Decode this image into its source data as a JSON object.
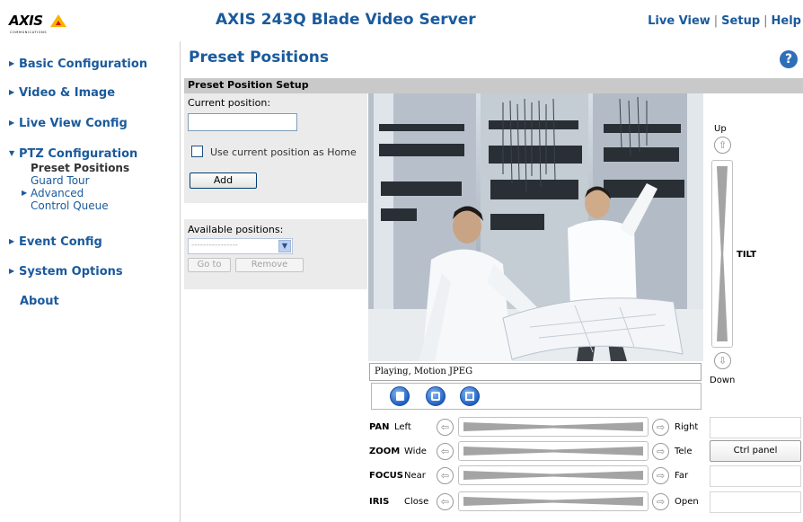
{
  "header": {
    "logo_text": "AXIS",
    "logo_subtext": "COMMUNICATIONS",
    "product_title": "AXIS 243Q Blade Video Server",
    "links": [
      "Live View",
      "Setup",
      "Help"
    ],
    "separator": "|"
  },
  "sidebar": {
    "items": [
      {
        "label": "Basic Configuration",
        "arrow": "▶"
      },
      {
        "label": "Video & Image",
        "arrow": "▶"
      },
      {
        "label": "Live View Config",
        "arrow": "▶"
      },
      {
        "label": "PTZ Configuration",
        "arrow": "▼"
      },
      {
        "label": "Event Config",
        "arrow": "▶"
      },
      {
        "label": "System Options",
        "arrow": "▶"
      },
      {
        "label": "About",
        "arrow": ""
      }
    ],
    "ptz_subitems": [
      {
        "label": "Preset Positions",
        "arrow": "",
        "active": true
      },
      {
        "label": "Guard Tour",
        "arrow": ""
      },
      {
        "label": "Advanced",
        "arrow": "▶"
      },
      {
        "label": "Control Queue",
        "arrow": ""
      }
    ]
  },
  "page": {
    "title": "Preset Positions",
    "help_icon": "?",
    "section_title": "Preset Position Setup"
  },
  "setup": {
    "current_position_label": "Current position:",
    "current_position_value": "",
    "home_checkbox_label": "Use current position as Home",
    "home_checked": false,
    "add_button": "Add"
  },
  "available": {
    "label": "Available positions:",
    "selected_option": "----------------",
    "goto_button": "Go to",
    "remove_button": "Remove"
  },
  "video": {
    "status": "Playing, Motion JPEG"
  },
  "tilt": {
    "label": "TILT",
    "up_label": "Up",
    "down_label": "Down"
  },
  "ptz_rows": [
    {
      "name": "PAN",
      "left": "Left",
      "right": "Right"
    },
    {
      "name": "ZOOM",
      "left": "Wide",
      "right": "Tele"
    },
    {
      "name": "FOCUS",
      "left": "Near",
      "right": "Far"
    },
    {
      "name": "IRIS",
      "left": "Close",
      "right": "Open"
    }
  ],
  "ctrl_panel_button": "Ctrl panel",
  "icons": {
    "left_arrow": "⇦",
    "right_arrow": "⇨",
    "up_arrow": "⇧",
    "down_arrow": "⇩",
    "dropdown": "▼"
  },
  "colors": {
    "link_blue": "#1a5a9c",
    "panel_gray": "#ebebeb",
    "section_bar": "#c9c9c9",
    "logo_yellow": "#f7b500"
  }
}
